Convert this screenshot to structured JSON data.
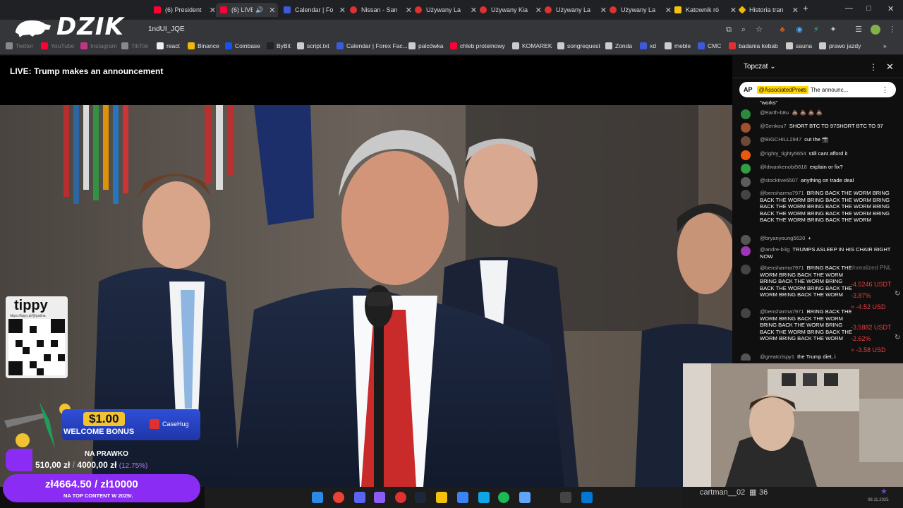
{
  "browser": {
    "tabs": [
      {
        "label": "(6) President",
        "favicon_color": "#ff0033"
      },
      {
        "label": "(6) LIVE:",
        "favicon_color": "#ff0033",
        "active": true
      },
      {
        "label": "Calendar | Fo",
        "favicon_color": "#3b5bdb"
      },
      {
        "label": "Nissan - San",
        "favicon_color": "#e03131"
      },
      {
        "label": "Używany La",
        "favicon_color": "#e03131"
      },
      {
        "label": "Używany Kia",
        "favicon_color": "#e03131"
      },
      {
        "label": "Używany La",
        "favicon_color": "#e03131"
      },
      {
        "label": "Używany La",
        "favicon_color": "#e03131"
      },
      {
        "label": "Katownik ró",
        "favicon_color": "#f4c20d"
      },
      {
        "label": "Historia tran",
        "favicon_color": "#f0b90b"
      }
    ],
    "new_tab": "+",
    "window_controls": [
      "—",
      "□",
      "✕"
    ],
    "url": "1ndUI_JQE",
    "bookmarks": [
      {
        "label": "Twitter",
        "color": "#888",
        "faded": true
      },
      {
        "label": "YouTube",
        "color": "#ff0033",
        "faded": true
      },
      {
        "label": "Instagram",
        "color": "#c13584",
        "faded": true
      },
      {
        "label": "TikTok",
        "color": "#888",
        "faded": true
      },
      {
        "label": "react",
        "color": "#eee"
      },
      {
        "label": "Binance",
        "color": "#f0b90b"
      },
      {
        "label": "Coinbase",
        "color": "#1652f0"
      },
      {
        "label": "ByBit",
        "color": "#222"
      },
      {
        "label": "script.txt",
        "color": "#ccc"
      },
      {
        "label": "Calendar | Forex Fac...",
        "color": "#3b5bdb"
      },
      {
        "label": "palcówka",
        "color": "#ccc"
      },
      {
        "label": "chleb proteinowy",
        "color": "#ff0033"
      },
      {
        "label": "KOMAREK",
        "color": "#ccc"
      },
      {
        "label": "songrequest",
        "color": "#ccc"
      },
      {
        "label": "Zonda",
        "color": "#ccc"
      },
      {
        "label": "xd",
        "color": "#3b5bdb"
      },
      {
        "label": "meble",
        "color": "#ccc"
      },
      {
        "label": "CMC",
        "color": "#3b5bdb"
      },
      {
        "label": "badania kebab",
        "color": "#e03131"
      },
      {
        "label": "sauna",
        "color": "#ccc"
      },
      {
        "label": "prawo jazdy",
        "color": "#ccc"
      }
    ],
    "bookmarks_more": "»"
  },
  "overlay_logo": "DZIK",
  "video": {
    "title": "LIVE: Trump makes an announcement"
  },
  "chat": {
    "title": "Topczat",
    "pinned": {
      "author": "@AssociatedPress",
      "text": "The announc..."
    },
    "messages": [
      {
        "author": "",
        "text": "\"works\"",
        "color": "#555"
      },
      {
        "author": "@Earth-b8u",
        "text": "💩 💩 💩 💩",
        "color": "#2b8a3e"
      },
      {
        "author": "@Senkou7",
        "text": "SHORT BTC TO 97SHORT BTC TO 97",
        "color": "#a0522d"
      },
      {
        "author": "@BIGCHILL2947",
        "text": "cut the 📸",
        "color": "#6c4a3a"
      },
      {
        "author": "@righty_tighty5654",
        "text": "still cant afford it",
        "color": "#e8590c"
      },
      {
        "author": "@ldwankenobi5618",
        "text": "explain or fix?",
        "color": "#2f9e44"
      },
      {
        "author": "@stocktive6507",
        "text": "anything on trade deal",
        "color": "#5c5c5c"
      },
      {
        "author": "@bensharma7971",
        "text": "BRING BACK THE WORM BRING BACK THE WORM BRING BACK THE WORM BRING BACK THE WORM BRING BACK THE WORM BRING BACK THE WORM BRING BACK THE WORM BRING BACK THE WORM BRING BACK THE WORM",
        "color": "#444"
      },
      {
        "author": "@bryanyoung5620",
        "text": "+",
        "color": "#555"
      },
      {
        "author": "@andre-b3g",
        "text": "TRUMPS ASLEEP IN HIS CHAIR RIGHT NOW",
        "color": "#9c36b5"
      },
      {
        "author": "@bensharma7971",
        "text": "BRING BACK THE WORM BRING BACK THE WORM BRING BACK THE WORM BRING BACK THE WORM BRING BACK THE WORM BRING BACK THE WORM",
        "color": "#444"
      },
      {
        "author": "@bensharma7971",
        "text": "BRING BACK THE WORM BRING BACK THE WORM BRING BACK THE WORM BRING BACK THE WORM BRING BACK THE WORM BRING BACK THE WORM",
        "color": "#444"
      },
      {
        "author": "@greatcrispy1",
        "text": "the Trump diet, i",
        "color": "#555"
      }
    ]
  },
  "pnl": {
    "header": "Unrealized PNL",
    "rows": [
      {
        "usdt": "-4.5246 USDT",
        "pct": "-3.87%",
        "approx": "≈ -4.52 USD"
      },
      {
        "usdt": "-3.5882 USDT",
        "pct": "-2.62%",
        "approx": "≈ -3.58 USD"
      }
    ]
  },
  "overlays": {
    "tippy_brand": "tippy",
    "tippy_url": "https://tippy.pl/@patina",
    "promo_amount": "$1.00",
    "promo_text": "WELCOME BONUS",
    "promo_brand": "CaseHug",
    "goal_label": "NA PRAWKO",
    "goal_current": "510,00 zł",
    "goal_target": "4000,00 zł",
    "goal_pct": "(12.75%)",
    "goal2_amount": "zł4664.50 / zł10000",
    "goal2_label": "NA TOP CONTENT W 2025r."
  },
  "webcam": {
    "username": "cartman__02",
    "count": "36"
  },
  "taskbar": {
    "icons": [
      "windows",
      "chrome",
      "discord",
      "app",
      "opera",
      "steam",
      "folder",
      "ccleaner",
      "vscode",
      "spotify",
      "notepad",
      "terminal",
      "photos"
    ],
    "clock": "08.11.2025"
  }
}
